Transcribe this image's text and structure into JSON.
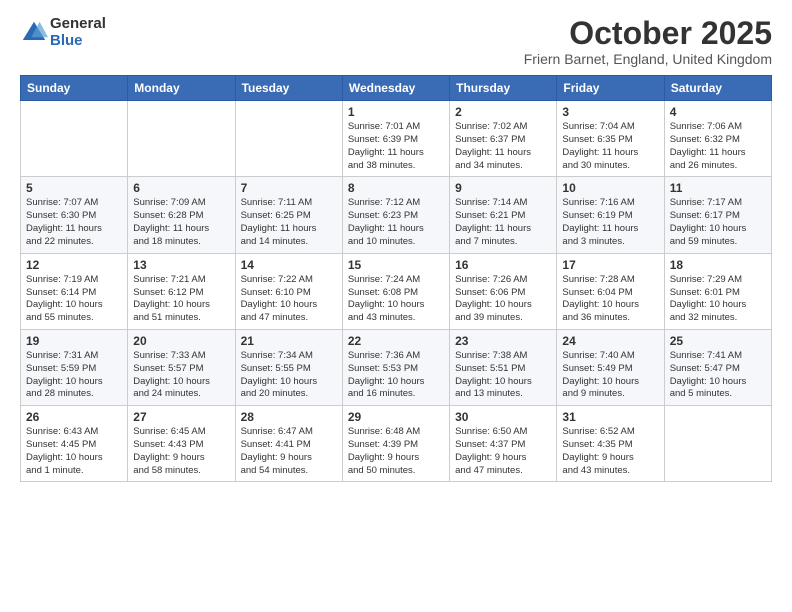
{
  "logo": {
    "general": "General",
    "blue": "Blue"
  },
  "header": {
    "month": "October 2025",
    "location": "Friern Barnet, England, United Kingdom"
  },
  "weekdays": [
    "Sunday",
    "Monday",
    "Tuesday",
    "Wednesday",
    "Thursday",
    "Friday",
    "Saturday"
  ],
  "weeks": [
    [
      {
        "day": "",
        "info": ""
      },
      {
        "day": "",
        "info": ""
      },
      {
        "day": "",
        "info": ""
      },
      {
        "day": "1",
        "info": "Sunrise: 7:01 AM\nSunset: 6:39 PM\nDaylight: 11 hours\nand 38 minutes."
      },
      {
        "day": "2",
        "info": "Sunrise: 7:02 AM\nSunset: 6:37 PM\nDaylight: 11 hours\nand 34 minutes."
      },
      {
        "day": "3",
        "info": "Sunrise: 7:04 AM\nSunset: 6:35 PM\nDaylight: 11 hours\nand 30 minutes."
      },
      {
        "day": "4",
        "info": "Sunrise: 7:06 AM\nSunset: 6:32 PM\nDaylight: 11 hours\nand 26 minutes."
      }
    ],
    [
      {
        "day": "5",
        "info": "Sunrise: 7:07 AM\nSunset: 6:30 PM\nDaylight: 11 hours\nand 22 minutes."
      },
      {
        "day": "6",
        "info": "Sunrise: 7:09 AM\nSunset: 6:28 PM\nDaylight: 11 hours\nand 18 minutes."
      },
      {
        "day": "7",
        "info": "Sunrise: 7:11 AM\nSunset: 6:25 PM\nDaylight: 11 hours\nand 14 minutes."
      },
      {
        "day": "8",
        "info": "Sunrise: 7:12 AM\nSunset: 6:23 PM\nDaylight: 11 hours\nand 10 minutes."
      },
      {
        "day": "9",
        "info": "Sunrise: 7:14 AM\nSunset: 6:21 PM\nDaylight: 11 hours\nand 7 minutes."
      },
      {
        "day": "10",
        "info": "Sunrise: 7:16 AM\nSunset: 6:19 PM\nDaylight: 11 hours\nand 3 minutes."
      },
      {
        "day": "11",
        "info": "Sunrise: 7:17 AM\nSunset: 6:17 PM\nDaylight: 10 hours\nand 59 minutes."
      }
    ],
    [
      {
        "day": "12",
        "info": "Sunrise: 7:19 AM\nSunset: 6:14 PM\nDaylight: 10 hours\nand 55 minutes."
      },
      {
        "day": "13",
        "info": "Sunrise: 7:21 AM\nSunset: 6:12 PM\nDaylight: 10 hours\nand 51 minutes."
      },
      {
        "day": "14",
        "info": "Sunrise: 7:22 AM\nSunset: 6:10 PM\nDaylight: 10 hours\nand 47 minutes."
      },
      {
        "day": "15",
        "info": "Sunrise: 7:24 AM\nSunset: 6:08 PM\nDaylight: 10 hours\nand 43 minutes."
      },
      {
        "day": "16",
        "info": "Sunrise: 7:26 AM\nSunset: 6:06 PM\nDaylight: 10 hours\nand 39 minutes."
      },
      {
        "day": "17",
        "info": "Sunrise: 7:28 AM\nSunset: 6:04 PM\nDaylight: 10 hours\nand 36 minutes."
      },
      {
        "day": "18",
        "info": "Sunrise: 7:29 AM\nSunset: 6:01 PM\nDaylight: 10 hours\nand 32 minutes."
      }
    ],
    [
      {
        "day": "19",
        "info": "Sunrise: 7:31 AM\nSunset: 5:59 PM\nDaylight: 10 hours\nand 28 minutes."
      },
      {
        "day": "20",
        "info": "Sunrise: 7:33 AM\nSunset: 5:57 PM\nDaylight: 10 hours\nand 24 minutes."
      },
      {
        "day": "21",
        "info": "Sunrise: 7:34 AM\nSunset: 5:55 PM\nDaylight: 10 hours\nand 20 minutes."
      },
      {
        "day": "22",
        "info": "Sunrise: 7:36 AM\nSunset: 5:53 PM\nDaylight: 10 hours\nand 16 minutes."
      },
      {
        "day": "23",
        "info": "Sunrise: 7:38 AM\nSunset: 5:51 PM\nDaylight: 10 hours\nand 13 minutes."
      },
      {
        "day": "24",
        "info": "Sunrise: 7:40 AM\nSunset: 5:49 PM\nDaylight: 10 hours\nand 9 minutes."
      },
      {
        "day": "25",
        "info": "Sunrise: 7:41 AM\nSunset: 5:47 PM\nDaylight: 10 hours\nand 5 minutes."
      }
    ],
    [
      {
        "day": "26",
        "info": "Sunrise: 6:43 AM\nSunset: 4:45 PM\nDaylight: 10 hours\nand 1 minute."
      },
      {
        "day": "27",
        "info": "Sunrise: 6:45 AM\nSunset: 4:43 PM\nDaylight: 9 hours\nand 58 minutes."
      },
      {
        "day": "28",
        "info": "Sunrise: 6:47 AM\nSunset: 4:41 PM\nDaylight: 9 hours\nand 54 minutes."
      },
      {
        "day": "29",
        "info": "Sunrise: 6:48 AM\nSunset: 4:39 PM\nDaylight: 9 hours\nand 50 minutes."
      },
      {
        "day": "30",
        "info": "Sunrise: 6:50 AM\nSunset: 4:37 PM\nDaylight: 9 hours\nand 47 minutes."
      },
      {
        "day": "31",
        "info": "Sunrise: 6:52 AM\nSunset: 4:35 PM\nDaylight: 9 hours\nand 43 minutes."
      },
      {
        "day": "",
        "info": ""
      }
    ]
  ]
}
